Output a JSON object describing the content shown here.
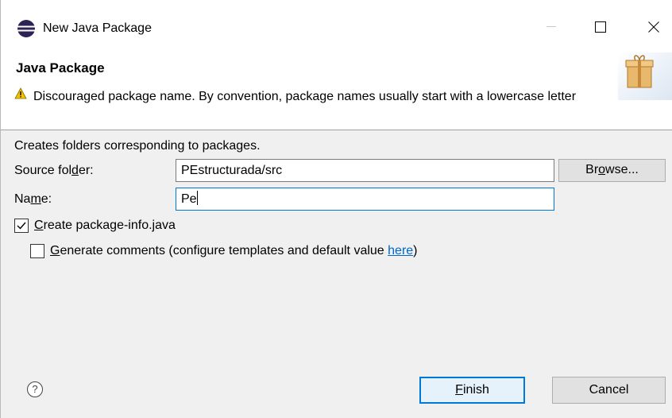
{
  "window": {
    "title": "New Java Package",
    "minimize_label": "—",
    "maximize_label": "☐",
    "close_label": "✕"
  },
  "header": {
    "title": "Java Package",
    "warning_text": "Discouraged package name. By convention, package names usually start with a lowercase letter",
    "warning_icon": "warning-icon"
  },
  "body": {
    "description": "Creates folders corresponding to packages.",
    "source_folder": {
      "label_pre": "Source fol",
      "label_mnemonic": "d",
      "label_post": "er:",
      "value": "PEstructurada/src",
      "browse_pre": "Br",
      "browse_mnemonic": "o",
      "browse_post": "wse..."
    },
    "name": {
      "label_pre": "Na",
      "label_mnemonic": "m",
      "label_post": "e:",
      "value": "Pe"
    },
    "create_package_info": {
      "checked": true,
      "label_mnemonic": "C",
      "label_rest": "reate package-info.java"
    },
    "generate_comments": {
      "checked": false,
      "label_mnemonic": "G",
      "label_rest": "enerate comments (configure templates and default value ",
      "link": "here",
      "label_end": ")"
    }
  },
  "footer": {
    "help_icon": "?",
    "finish_mnemonic": "F",
    "finish_rest": "inish",
    "cancel": "Cancel"
  },
  "colors": {
    "accent": "#0078d7",
    "link": "#0066cc",
    "dialog_bg": "#f0f0f0"
  }
}
